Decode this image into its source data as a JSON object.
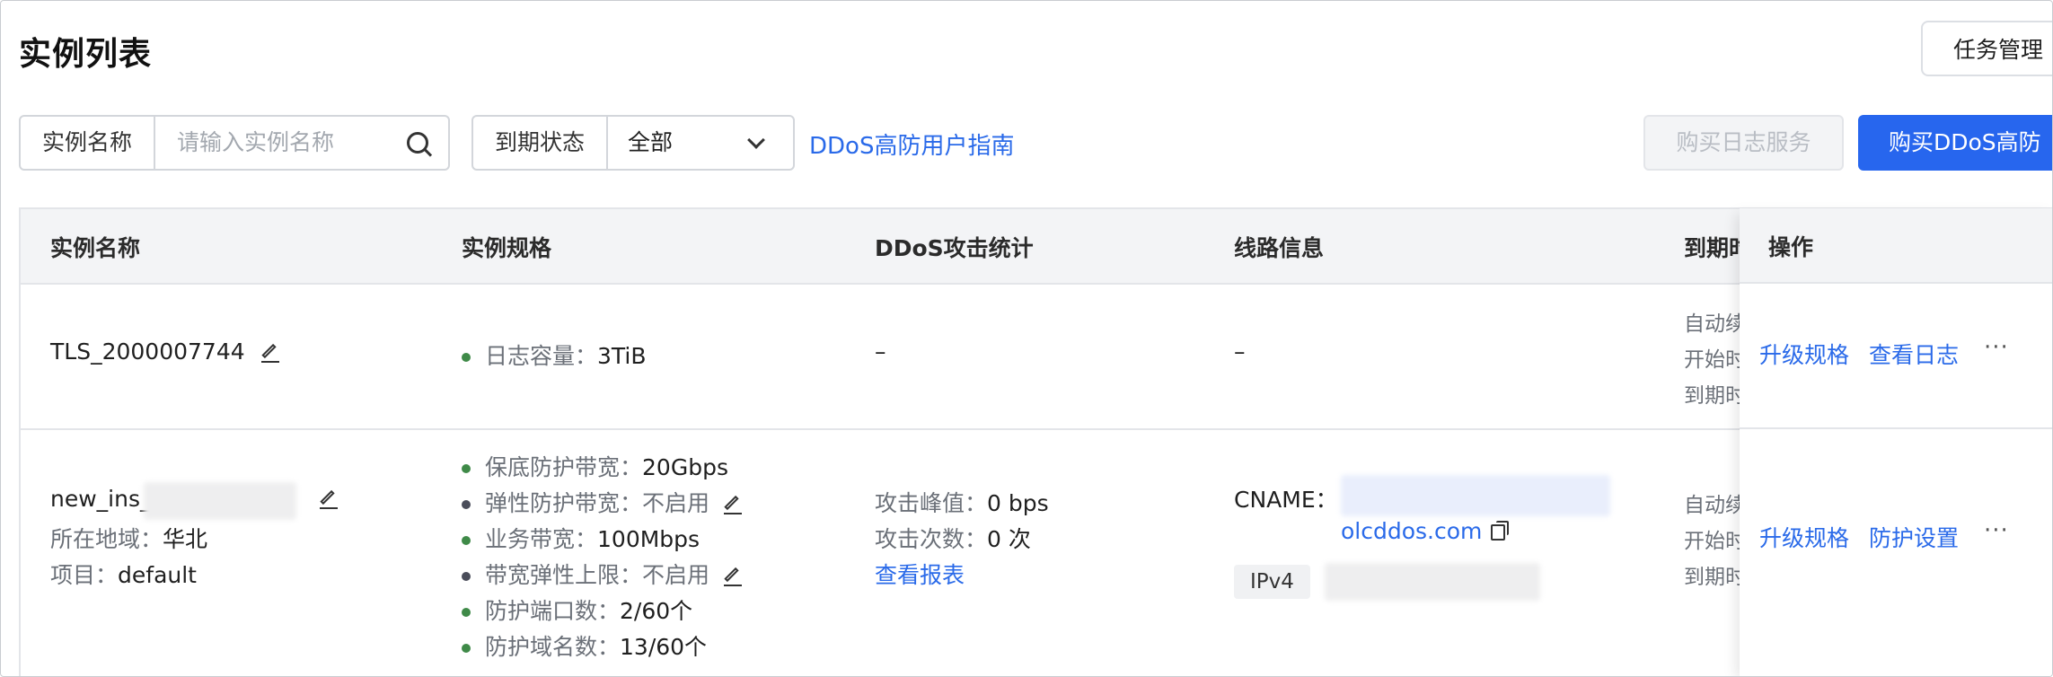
{
  "page": {
    "title": "实例列表"
  },
  "header": {
    "task_button": "任务管理"
  },
  "filters": {
    "name_label": "实例名称",
    "name_placeholder": "请输入实例名称",
    "expire_label": "到期状态",
    "expire_value": "全部",
    "guide_link": "DDoS高防用户指南"
  },
  "actions": {
    "buy_log": "购买日志服务",
    "buy_ddos": "购买DDoS高防"
  },
  "table": {
    "columns": [
      "实例名称",
      "实例规格",
      "DDoS攻击统计",
      "线路信息",
      "到期时",
      "操作"
    ],
    "rows": [
      {
        "name": "TLS_2000007744",
        "spec": [
          {
            "label": "日志容量：",
            "value": "3TiB",
            "dot": "green"
          }
        ],
        "attack": "–",
        "line": "–",
        "expire": [
          "自动续",
          "开始时",
          "到期时"
        ],
        "ops": [
          "升级规格",
          "查看日志"
        ]
      },
      {
        "name": "new_ins_",
        "region_label": "所在地域：",
        "region": "华北",
        "project_label": "项目：",
        "project": "default",
        "spec": [
          {
            "label": "保底防护带宽：",
            "value": "20Gbps",
            "dot": "green"
          },
          {
            "label": "弹性防护带宽：",
            "value": "不启用",
            "dot": "dark"
          },
          {
            "label": "业务带宽：",
            "value": "100Mbps",
            "dot": "green"
          },
          {
            "label": "带宽弹性上限：",
            "value": "不启用",
            "dot": "dark"
          },
          {
            "label": "防护端口数：",
            "value": "2/60个",
            "dot": "green"
          },
          {
            "label": "防护域名数：",
            "value": "13/60个",
            "dot": "green"
          }
        ],
        "attack_peak_label": "攻击峰值：",
        "attack_peak": "0 bps",
        "attack_count_label": "攻击次数：",
        "attack_count": "0 次",
        "report_link": "查看报表",
        "cname_label": "CNAME：",
        "cname_domain": "olcddos.com",
        "ip_tag": "IPv4",
        "expire": [
          "自动续",
          "开始时",
          "到期时"
        ],
        "ops": [
          "升级规格",
          "防护设置"
        ]
      }
    ]
  },
  "icons": [
    "search-icon",
    "chevron-down-icon",
    "pencil-icon",
    "copy-icon",
    "more-icon"
  ],
  "colors": {
    "primary": "#2766ee",
    "link": "#2a6ae9",
    "status_green": "#3f8a48",
    "status_dark": "#4a4d5a"
  }
}
